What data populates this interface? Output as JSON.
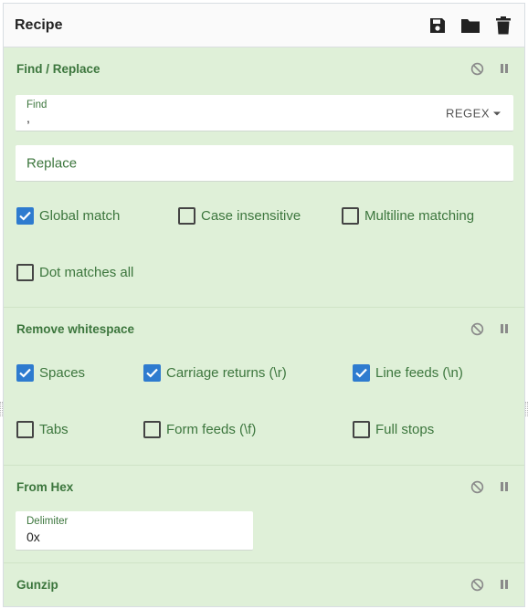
{
  "header": {
    "title": "Recipe",
    "icons": [
      "save-icon",
      "folder-icon",
      "trash-icon"
    ]
  },
  "operations": {
    "find_replace": {
      "title": "Find / Replace",
      "find_label": "Find",
      "find_value": ",",
      "regex_label": "REGEX",
      "replace_placeholder": "Replace",
      "options": {
        "global": {
          "label": "Global match",
          "checked": true
        },
        "case": {
          "label": "Case insensitive",
          "checked": false
        },
        "multiline": {
          "label": "Multiline matching",
          "checked": false
        },
        "dotall": {
          "label": "Dot matches all",
          "checked": false
        }
      }
    },
    "remove_whitespace": {
      "title": "Remove whitespace",
      "options": {
        "spaces": {
          "label": "Spaces",
          "checked": true
        },
        "cr": {
          "label": "Carriage returns (\\r)",
          "checked": true
        },
        "lf": {
          "label": "Line feeds (\\n)",
          "checked": true
        },
        "tabs": {
          "label": "Tabs",
          "checked": false
        },
        "ff": {
          "label": "Form feeds (\\f)",
          "checked": false
        },
        "stops": {
          "label": "Full stops",
          "checked": false
        }
      }
    },
    "from_hex": {
      "title": "From Hex",
      "delimiter_label": "Delimiter",
      "delimiter_value": "0x"
    },
    "gunzip": {
      "title": "Gunzip"
    }
  },
  "colors": {
    "accent_green": "#3c763d",
    "panel_bg": "#dff0d8",
    "checkbox_blue": "#2e7bcf"
  }
}
